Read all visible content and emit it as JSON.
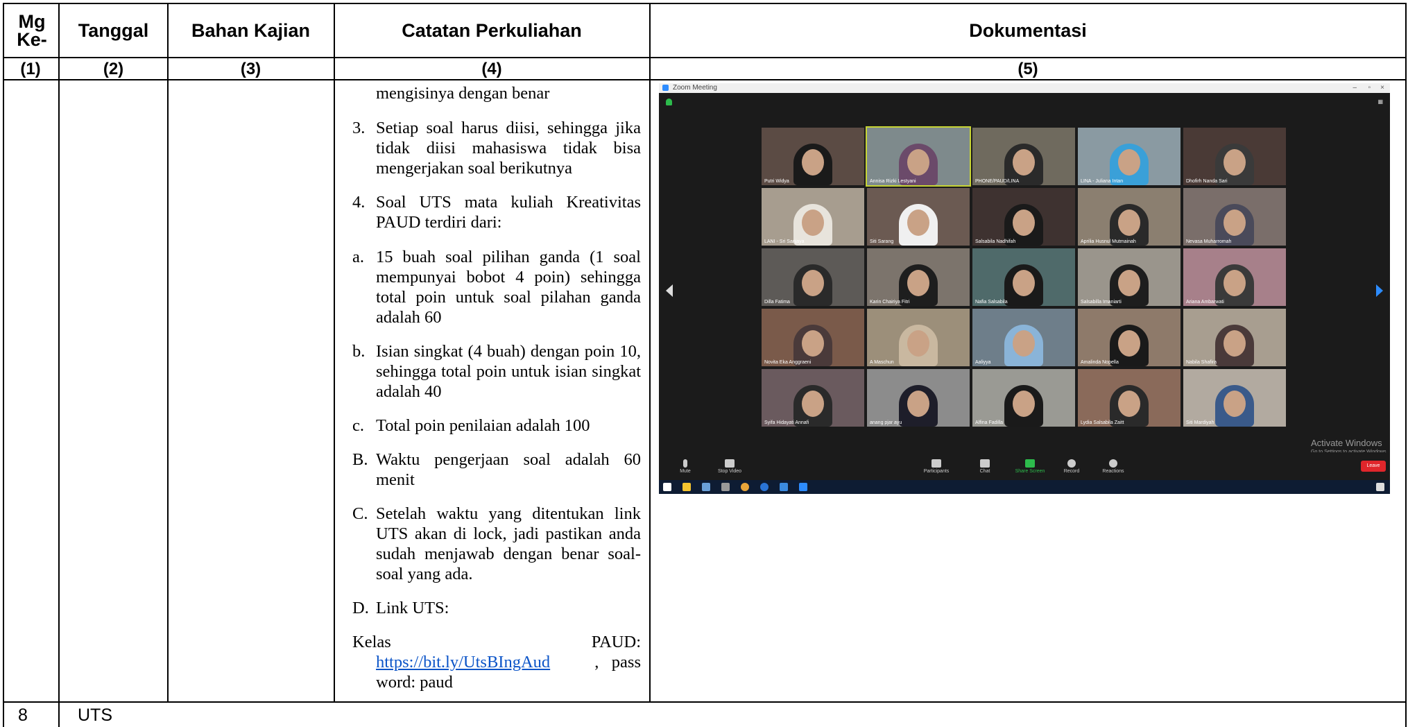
{
  "table": {
    "headers": {
      "col1": "Mg Ke-",
      "col2": "Tanggal",
      "col3": "Bahan Kajian",
      "col4": "Catatan Perkuliahan",
      "col5": "Dokumentasi"
    },
    "numbers": [
      "(1)",
      "(2)",
      "(3)",
      "(4)",
      "(5)"
    ],
    "notes": {
      "top_line": "mengisinya dengan benar",
      "items": [
        {
          "label": "3.",
          "text": "Setiap soal harus diisi, sehingga jika tidak diisi mahasiswa tidak bisa mengerjakan soal berikutnya"
        },
        {
          "label": "4.",
          "text": "Soal UTS mata kuliah Kreativitas PAUD terdiri dari:"
        },
        {
          "label": "a.",
          "text": "15 buah soal pilihan ganda (1 soal mempunyai bobot 4 poin) sehingga total poin untuk soal pilahan ganda adalah 60"
        },
        {
          "label": "b.",
          "text": "Isian singkat (4 buah) dengan poin 10, sehingga total poin untuk isian singkat adalah 40"
        },
        {
          "label": "c.",
          "text": "Total poin penilaian adalah 100"
        },
        {
          "label": "B.",
          "text": "Waktu pengerjaan soal adalah 60 menit"
        },
        {
          "label": "C.",
          "text": "Setelah waktu yang ditentukan link UTS akan di lock, jadi pastikan anda sudah menjawab dengan benar soal-soal yang ada."
        },
        {
          "label": "D.",
          "text": "Link UTS:"
        }
      ],
      "kelas_label": "Kelas",
      "kelas_value": "PAUD:",
      "link": "https://bit.ly/UtsBIngAud",
      "pass_suffix": ",   pass",
      "password_line": "word: paud"
    },
    "footer_row": {
      "week": "8",
      "label": "UTS"
    }
  },
  "documentation": {
    "window_title": "Zoom Meeting",
    "participants": [
      "Putri Widya",
      "Annisa Rizki Lestyani",
      "PHONE/PAUD/LINA",
      "LINA - Juliana Intan",
      "Dhofirh Nanda Sari",
      "LANI - Sri Sanjaya",
      "Siti Sarang",
      "Salsabila Nadhifah",
      "Aprilia Husnul Mutmainah",
      "Nevasa Muharromah",
      "Dilla Fatima",
      "Karin Chairiya Fitri",
      "Nafia Salsabila",
      "Salsabilla Imaniarti",
      "Ariana Ambarwati",
      "Novita Eka Anggraeni",
      "A Maschun",
      "Aaliyya",
      "Amalinda Nopella",
      "Nabila Shafira",
      "Syifa Hidayati Annafi",
      "anang pjar ayu",
      "Alfina Fadilla",
      "Lydia Salsabila Zaitt",
      "Siti Mardiyah"
    ],
    "toolbar": [
      "Mute",
      "Stop Video",
      "Participants",
      "Chat",
      "Share Screen",
      "Record",
      "Reactions",
      "Leave"
    ],
    "activate_line1": "Activate Windows",
    "activate_line2": "Go to Settings to activate Windows.",
    "colors": {
      "share": "#2dbb4c",
      "leave": "#e0262b",
      "active_speaker": "#c7d434"
    }
  }
}
